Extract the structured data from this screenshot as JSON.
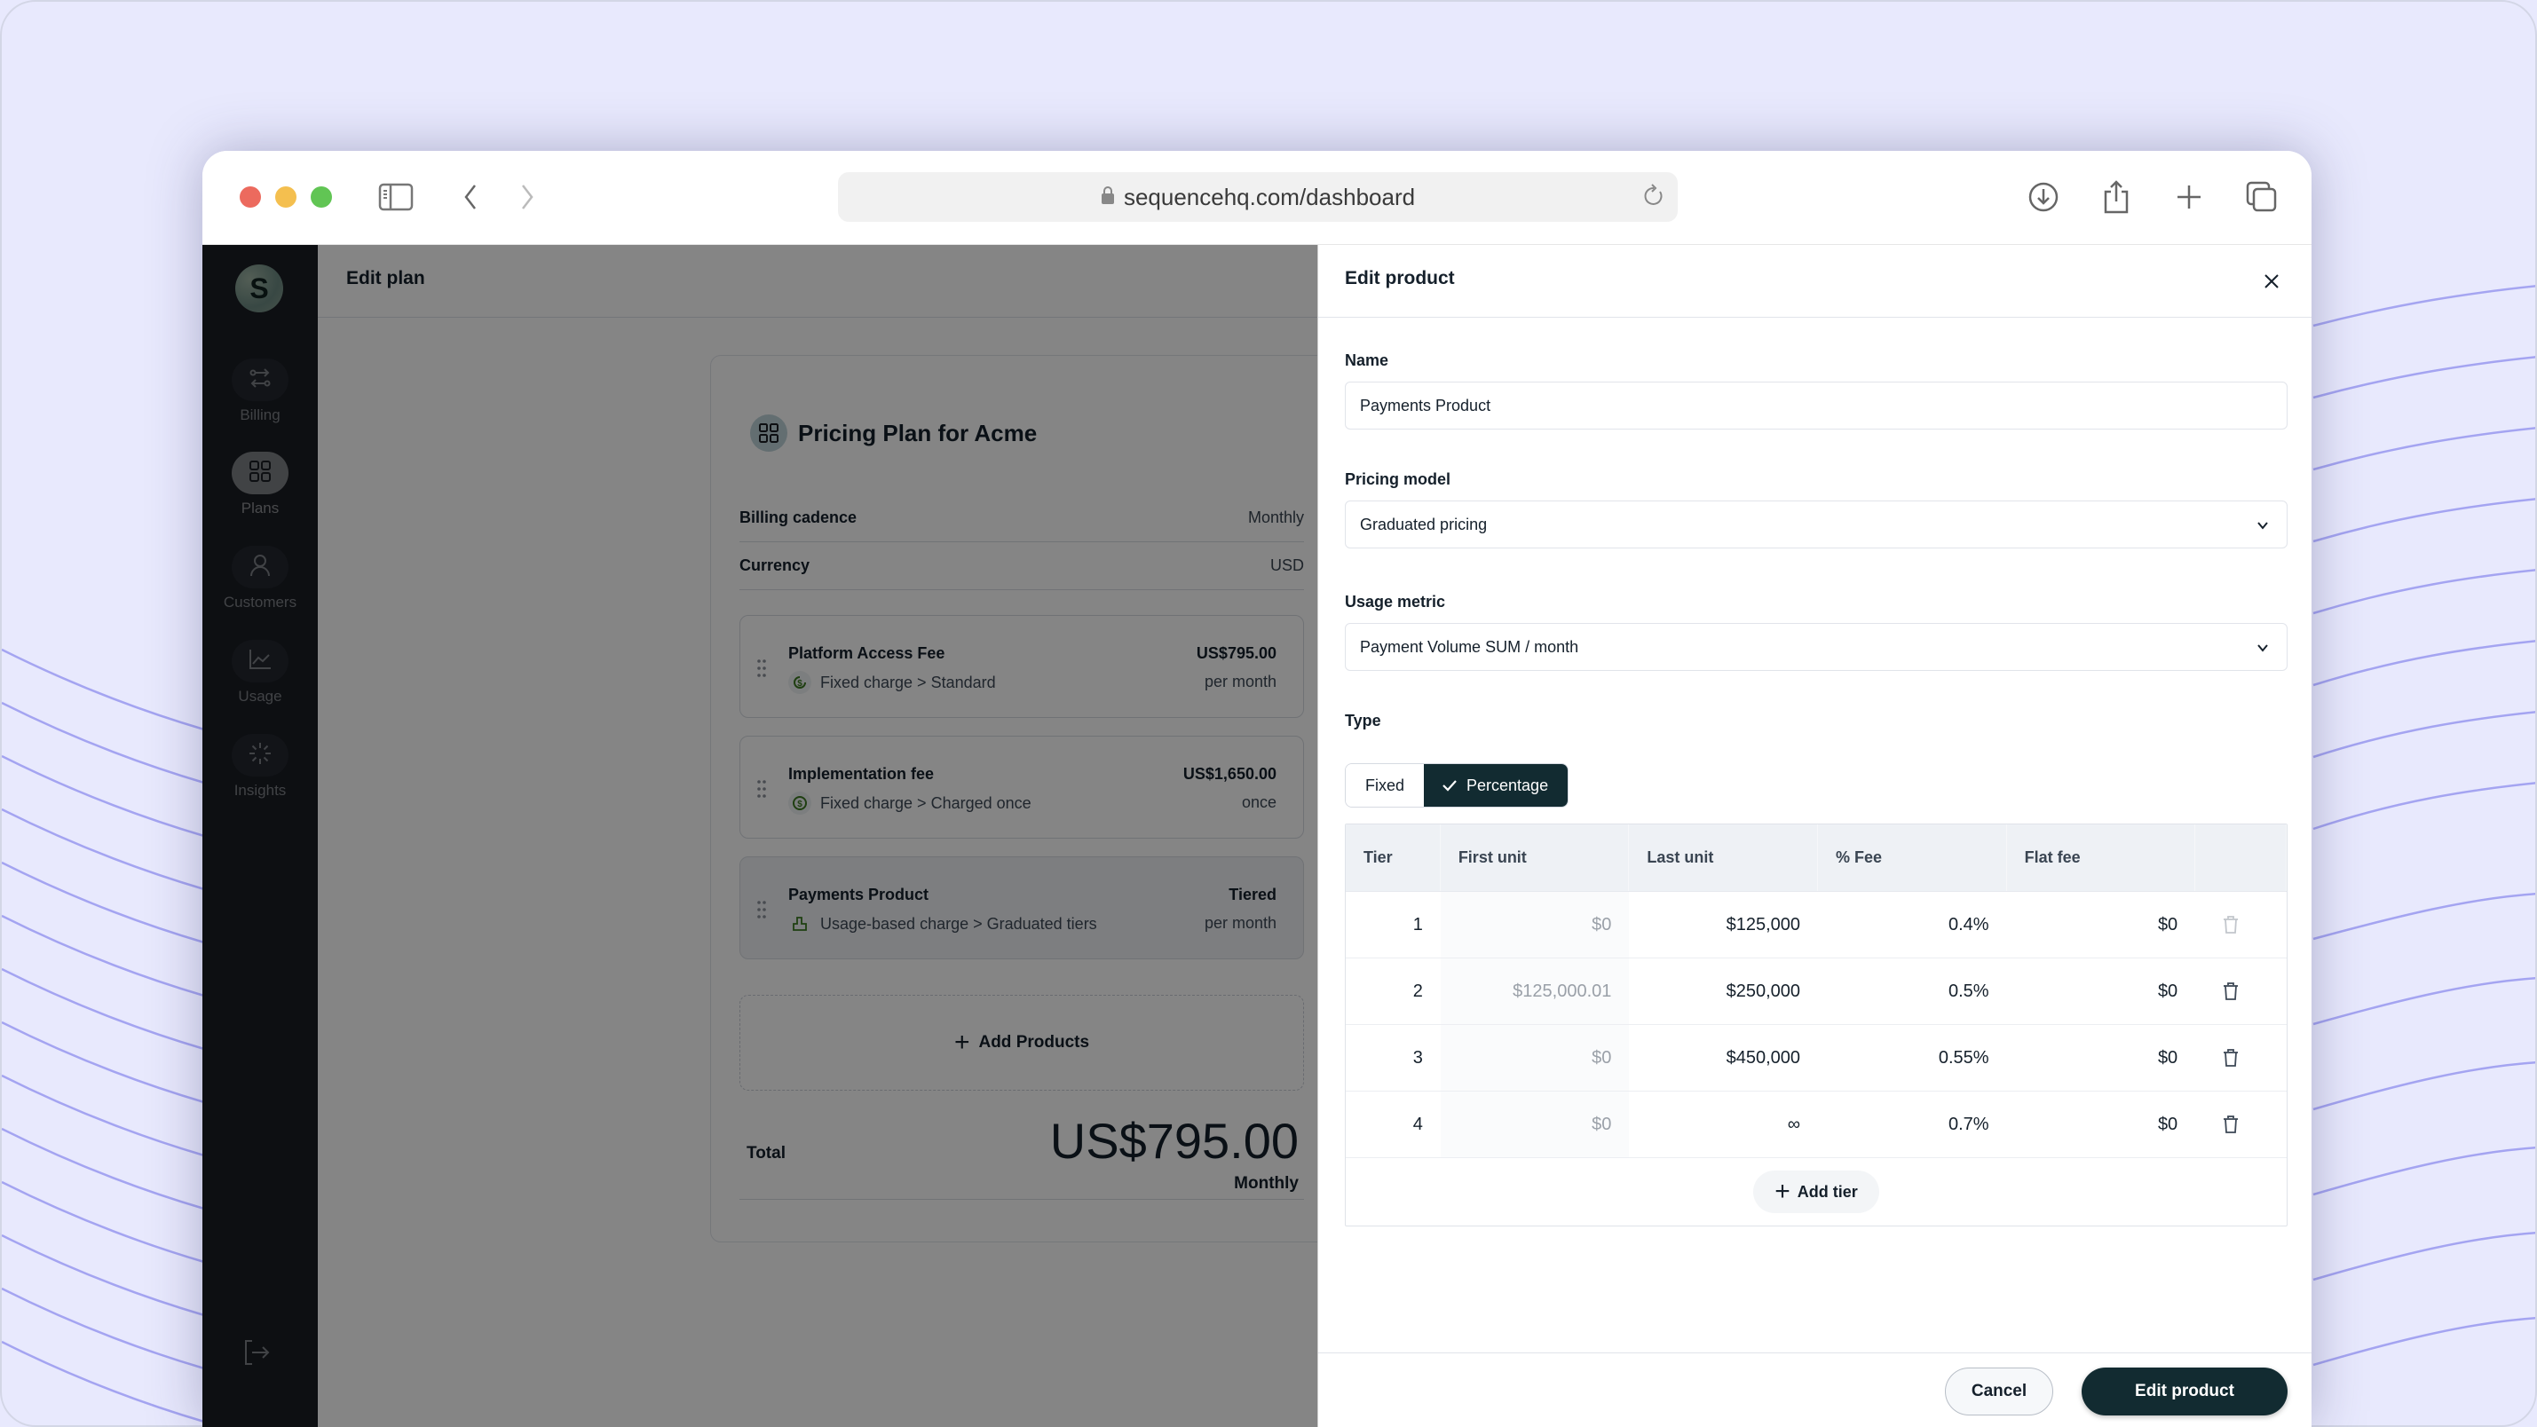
{
  "browser": {
    "url": "sequencehq.com/dashboard"
  },
  "sidebar": {
    "avatar_initial": "S",
    "items": [
      {
        "label": "Billing",
        "icon": "arrows-exchange-icon",
        "active": false
      },
      {
        "label": "Plans",
        "icon": "grid-icon",
        "active": true
      },
      {
        "label": "Customers",
        "icon": "user-icon",
        "active": false
      },
      {
        "label": "Usage",
        "icon": "chart-line-icon",
        "active": false
      },
      {
        "label": "Insights",
        "icon": "loader-burst-icon",
        "active": false
      }
    ],
    "logout_icon": "logout-icon"
  },
  "page": {
    "title": "Edit plan"
  },
  "plan": {
    "title": "Pricing Plan for Acme",
    "billing_cadence_label": "Billing cadence",
    "billing_cadence_value": "Monthly",
    "currency_label": "Currency",
    "currency_value": "USD",
    "products": [
      {
        "name": "Platform Access Fee",
        "subtitle": "Fixed charge > Standard",
        "price": "US$795.00",
        "period": "per month",
        "icon": "recurring-dollar-icon"
      },
      {
        "name": "Implementation fee",
        "subtitle": "Fixed charge > Charged once",
        "price": "US$1,650.00",
        "period": "once",
        "icon": "dollar-circle-icon"
      },
      {
        "name": "Payments Product",
        "subtitle": "Usage-based charge > Graduated tiers",
        "price": "Tiered",
        "period": "per month",
        "icon": "usage-icon"
      }
    ],
    "add_products_label": "Add Products",
    "total_label": "Total",
    "total_value": "US$795.00",
    "total_period": "Monthly"
  },
  "drawer": {
    "title": "Edit product",
    "name_label": "Name",
    "name_value": "Payments Product",
    "pricing_model_label": "Pricing model",
    "pricing_model_value": "Graduated pricing",
    "usage_metric_label": "Usage metric",
    "usage_metric_value": "Payment Volume SUM / month",
    "type_label": "Type",
    "type_options": [
      "Fixed",
      "Percentage"
    ],
    "type_selected": "Percentage",
    "table": {
      "headers": [
        "Tier",
        "First unit",
        "Last unit",
        "% Fee",
        "Flat fee"
      ],
      "rows": [
        {
          "tier": "1",
          "first_unit": "$0",
          "last_unit": "$125,000",
          "fee": "0.4%",
          "flat_fee": "$0",
          "delete_enabled": false
        },
        {
          "tier": "2",
          "first_unit": "$125,000.01",
          "last_unit": "$250,000",
          "fee": "0.5%",
          "flat_fee": "$0",
          "delete_enabled": true
        },
        {
          "tier": "3",
          "first_unit": "$0",
          "last_unit": "$450,000",
          "fee": "0.55%",
          "flat_fee": "$0",
          "delete_enabled": true
        },
        {
          "tier": "4",
          "first_unit": "$0",
          "last_unit": "∞",
          "fee": "0.7%",
          "flat_fee": "$0",
          "delete_enabled": true
        }
      ],
      "add_tier_label": "Add tier"
    },
    "cancel_label": "Cancel",
    "submit_label": "Edit product"
  },
  "colors": {
    "primary": "#122b31",
    "sidebar_bg": "#1a1d24",
    "background": "#e8e9fd",
    "accent_lines": "#9a9aea",
    "charge_icon_green": "#3d7a22"
  }
}
